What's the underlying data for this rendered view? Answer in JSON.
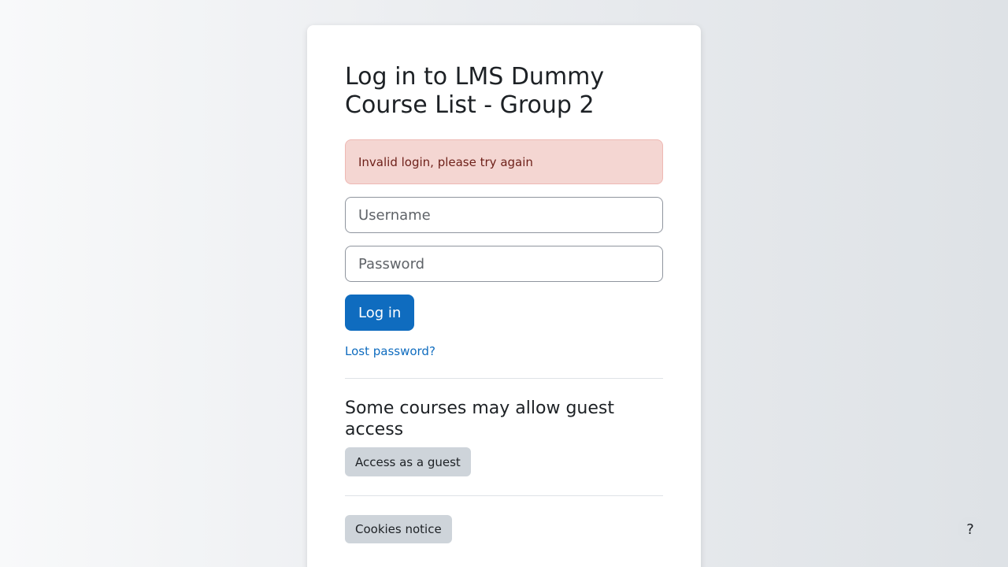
{
  "login": {
    "heading": "Log in to LMS Dummy Course List - Group 2",
    "error_message": "Invalid login, please try again",
    "username_placeholder": "Username",
    "password_placeholder": "Password",
    "login_button_label": "Log in",
    "lost_password_link": "Lost password?"
  },
  "guest": {
    "heading": "Some courses may allow guest access",
    "button_label": "Access as a guest"
  },
  "footer": {
    "cookies_button_label": "Cookies notice"
  },
  "help": {
    "icon_glyph": "?",
    "icon": "question-mark-icon"
  },
  "colors": {
    "primary": "#0f6cbf",
    "error_bg": "#f4d6d2",
    "error_text": "#6e211a",
    "secondary_button": "#ced4da"
  }
}
